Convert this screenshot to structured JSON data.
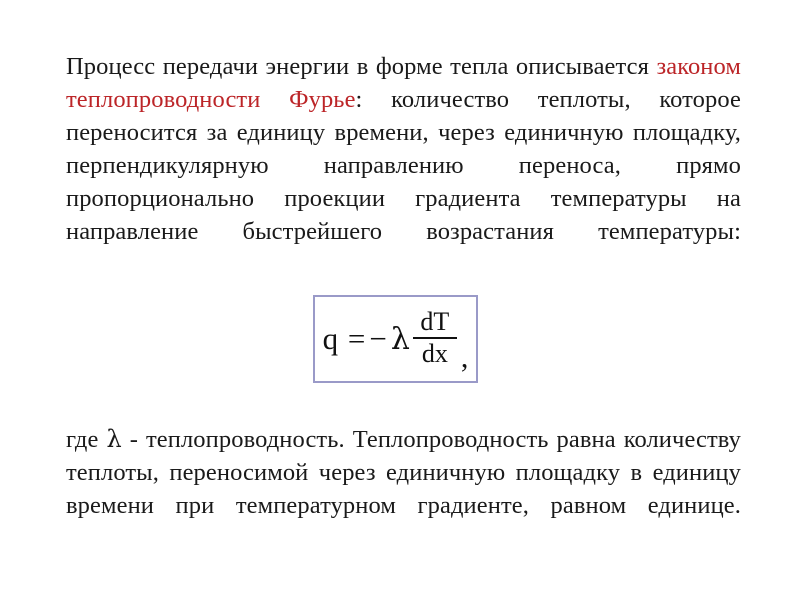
{
  "slide": {
    "background_color": "#ffffff",
    "text_color": "#1a1a1a",
    "accent_color": "#bc2528",
    "formula_border_color": "#9a9ac8"
  },
  "paragraph_1": {
    "segment_1": "Процесс передачи энергии в форме тепла описывается ",
    "segment_accent": "законом теплопроводности Фурье",
    "segment_2": ": количество теплоты, которое переносится за единицу времени, через единичную площадку, перпендикулярную направлению переноса, прямо пропорционально  проекции градиента температуры на направление быстрейшего возрастания температуры:"
  },
  "formula": {
    "lhs": "q =",
    "minus": "−",
    "lambda": "λ",
    "numerator": "dT",
    "denominator": "dx",
    "trailing_comma": ",",
    "plain_text": "q = −λ dT/dx ,"
  },
  "paragraph_2": {
    "segment_1": "где ",
    "lambda": "λ",
    "segment_2": " - теплопроводность. Теплопроводность равна количеству теплоты, переносимой через единичную площадку в единицу времени при температурном градиенте, равном единице."
  }
}
